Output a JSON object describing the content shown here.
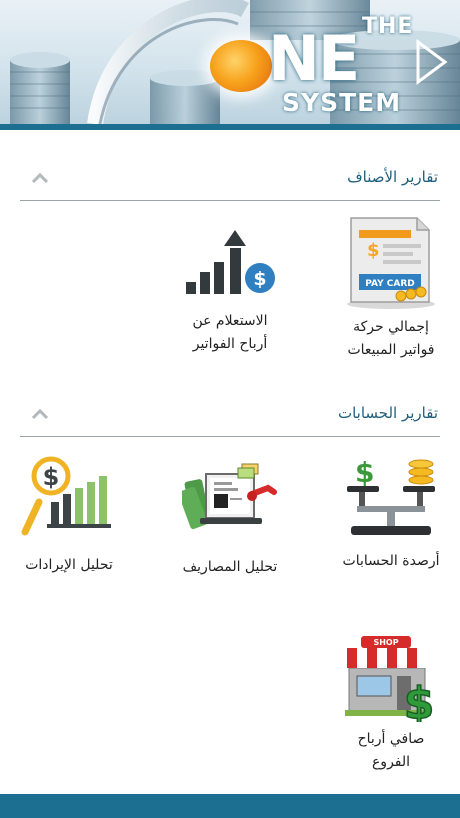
{
  "banner": {
    "logo_the": "THE",
    "logo_ne": "NE",
    "logo_system": "SYSTEM"
  },
  "sections": [
    {
      "title": "تقارير الأصناف",
      "tiles": [
        {
          "label": "إجمالي حركة\nفواتير المبيعات",
          "icon": "pay-card-invoice-icon",
          "card_text": "PAY CARD"
        },
        {
          "label": "الاستعلام عن\nأرباح الفواتير",
          "icon": "profit-bar-chart-icon"
        }
      ]
    },
    {
      "title": "تقارير الحسابات",
      "tiles": [
        {
          "label": "أرصدة الحسابات",
          "icon": "balance-scale-icon"
        },
        {
          "label": "تحليل المصاريف",
          "icon": "expenses-laptop-icon"
        },
        {
          "label": "تحليل الإيرادات",
          "icon": "revenue-magnifier-chart-icon"
        },
        {
          "label": "صافي أرباح\nالفروع",
          "icon": "branch-shop-icon",
          "shop_text": "SHOP"
        }
      ]
    }
  ],
  "colors": {
    "brand": "#1c6f90",
    "title": "#1f5f7d",
    "divider": "#9aa4a9"
  }
}
